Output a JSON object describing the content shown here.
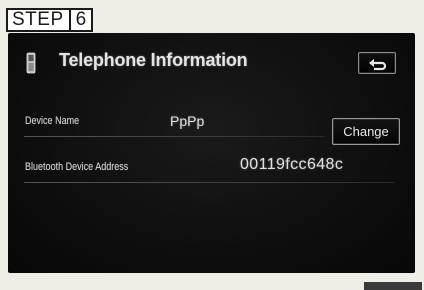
{
  "step": {
    "label": "STEP",
    "number": "6"
  },
  "header": {
    "title": "Telephone Information",
    "phone_icon": "mobile-phone-icon",
    "back_icon": "return-arrow-icon"
  },
  "device": {
    "label": "Device Name",
    "value": "PpPp",
    "change_label": "Change"
  },
  "bluetooth": {
    "label": "Bluetooth Device Address",
    "value": "00119fcc648c"
  },
  "colors": {
    "screen_bg": "#0e0e0e",
    "text": "#e4e4e4",
    "button_border": "#9a9a9a",
    "page_bg": "#efeee6"
  }
}
